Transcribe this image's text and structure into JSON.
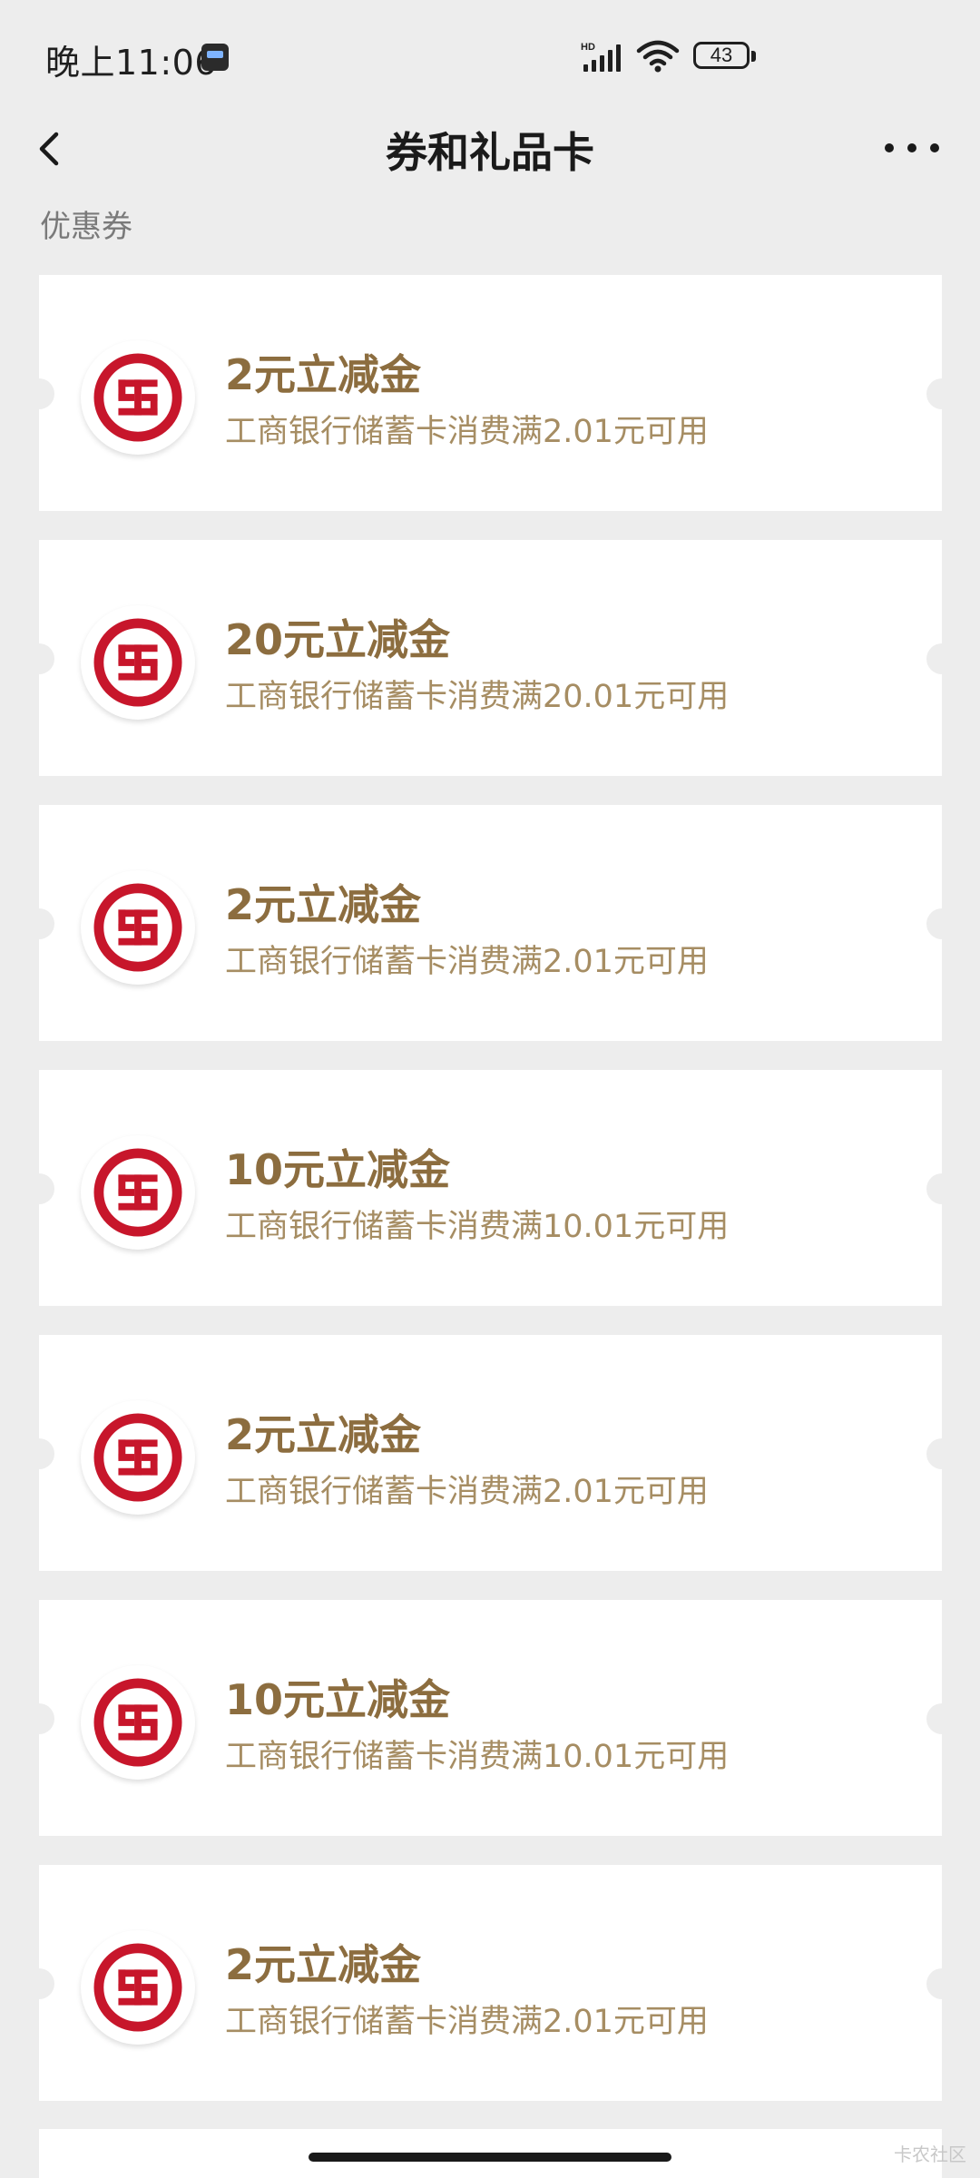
{
  "status_bar": {
    "time": "晚上11:06",
    "network": "HD",
    "battery": "43"
  },
  "nav": {
    "title": "券和礼品卡",
    "back_icon": "chevron-left-icon",
    "more_icon": "more-horizontal-icon"
  },
  "section_label": "优惠券",
  "coupons": [
    {
      "title": "2元立减金",
      "desc": "工商银行储蓄卡消费满2.01元可用",
      "logo": "icbc-logo-icon"
    },
    {
      "title": "20元立减金",
      "desc": "工商银行储蓄卡消费满20.01元可用",
      "logo": "icbc-logo-icon"
    },
    {
      "title": "2元立减金",
      "desc": "工商银行储蓄卡消费满2.01元可用",
      "logo": "icbc-logo-icon"
    },
    {
      "title": "10元立减金",
      "desc": "工商银行储蓄卡消费满10.01元可用",
      "logo": "icbc-logo-icon"
    },
    {
      "title": "2元立减金",
      "desc": "工商银行储蓄卡消费满2.01元可用",
      "logo": "icbc-logo-icon"
    },
    {
      "title": "10元立减金",
      "desc": "工商银行储蓄卡消费满10.01元可用",
      "logo": "icbc-logo-icon"
    },
    {
      "title": "2元立减金",
      "desc": "工商银行储蓄卡消费满2.01元可用",
      "logo": "icbc-logo-icon"
    }
  ],
  "watermark": "卡农社区",
  "colors": {
    "coupon_title": "#8c6d3f",
    "coupon_desc": "#a68d63",
    "icbc_red": "#c7162b",
    "background": "#ededed"
  }
}
